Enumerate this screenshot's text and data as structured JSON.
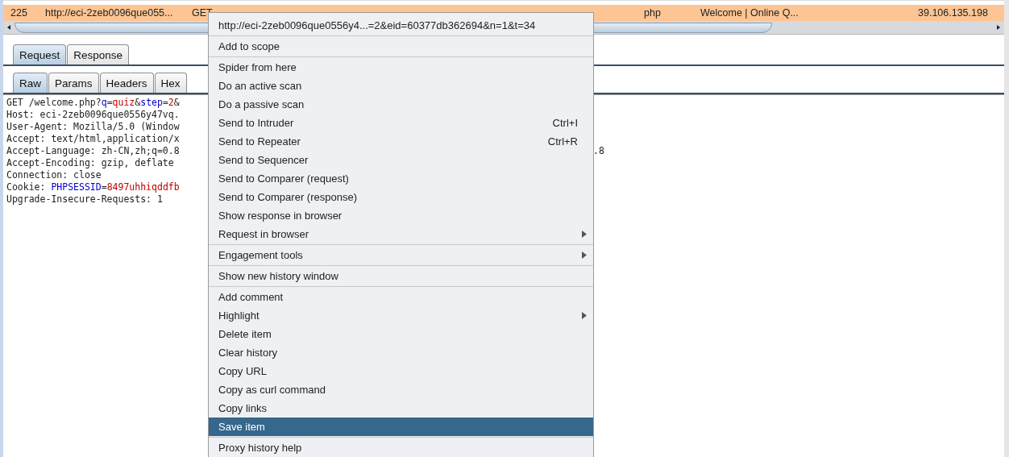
{
  "history_row": {
    "selected": true,
    "cells": [
      "225",
      "http://eci-2zeb0096que055...",
      "GET",
      "php",
      "Welcome | Online Q...",
      "39.106.135.198"
    ]
  },
  "tabs": [
    {
      "label": "Request",
      "selected": true
    },
    {
      "label": "Response",
      "selected": false
    }
  ],
  "subtabs": [
    {
      "label": "Raw",
      "selected": true
    },
    {
      "label": "Params",
      "selected": false
    },
    {
      "label": "Headers",
      "selected": false
    },
    {
      "label": "Hex",
      "selected": false
    }
  ],
  "request_lines": [
    {
      "segments": [
        {
          "kind": "plain",
          "text": "GET /welcome.php?"
        },
        {
          "kind": "name",
          "text": "q"
        },
        {
          "kind": "plain",
          "text": "="
        },
        {
          "kind": "value",
          "text": "quiz"
        },
        {
          "kind": "plain",
          "text": "&"
        },
        {
          "kind": "name",
          "text": "step"
        },
        {
          "kind": "plain",
          "text": "="
        },
        {
          "kind": "value",
          "text": "2"
        },
        {
          "kind": "plain",
          "text": "&"
        }
      ]
    },
    {
      "segments": [
        {
          "kind": "plain",
          "text": "Host: eci-2zeb0096que0556y47vq."
        }
      ]
    },
    {
      "segments": [
        {
          "kind": "plain",
          "text": "User-Agent: Mozilla/5.0 (Window"
        }
      ]
    },
    {
      "segments": [
        {
          "kind": "plain",
          "text": "Accept: text/html,application/x"
        }
      ]
    },
    {
      "segments": [
        {
          "kind": "plain",
          "text": "Accept-Language: zh-CN,zh;q=0.8"
        }
      ],
      "tail": ".8"
    },
    {
      "segments": [
        {
          "kind": "plain",
          "text": "Accept-Encoding: gzip, deflate"
        }
      ]
    },
    {
      "segments": [
        {
          "kind": "plain",
          "text": "Connection: close"
        }
      ]
    },
    {
      "segments": [
        {
          "kind": "plain",
          "text": "Cookie: "
        },
        {
          "kind": "name",
          "text": "PHPSESSID"
        },
        {
          "kind": "plain",
          "text": "="
        },
        {
          "kind": "value",
          "text": "8497uhhiqddfb"
        }
      ]
    },
    {
      "segments": [
        {
          "kind": "plain",
          "text": "Upgrade-Insecure-Requests: 1"
        }
      ]
    }
  ],
  "context_menu": {
    "sections": [
      [
        {
          "label": "http://eci-2zeb0096que0556y4...=2&eid=60377db362694&n=1&t=34",
          "has_submenu": false,
          "selected": false
        }
      ],
      [
        {
          "label": "Add to scope",
          "has_submenu": false,
          "selected": false
        }
      ],
      [
        {
          "label": "Spider from here",
          "has_submenu": false,
          "selected": false
        },
        {
          "label": "Do an active scan",
          "has_submenu": false,
          "selected": false
        },
        {
          "label": "Do a passive scan",
          "has_submenu": false,
          "selected": false
        },
        {
          "label": "Send to Intruder",
          "shortcut": "Ctrl+I",
          "has_submenu": false,
          "selected": false
        },
        {
          "label": "Send to Repeater",
          "shortcut": "Ctrl+R",
          "has_submenu": false,
          "selected": false
        },
        {
          "label": "Send to Sequencer",
          "has_submenu": false,
          "selected": false
        },
        {
          "label": "Send to Comparer (request)",
          "has_submenu": false,
          "selected": false
        },
        {
          "label": "Send to Comparer (response)",
          "has_submenu": false,
          "selected": false
        },
        {
          "label": "Show response in browser",
          "has_submenu": false,
          "selected": false
        },
        {
          "label": "Request in browser",
          "has_submenu": true,
          "selected": false
        }
      ],
      [
        {
          "label": "Engagement tools",
          "has_submenu": true,
          "selected": false
        }
      ],
      [
        {
          "label": "Show new history window",
          "has_submenu": false,
          "selected": false
        }
      ],
      [
        {
          "label": "Add comment",
          "has_submenu": false,
          "selected": false
        },
        {
          "label": "Highlight",
          "has_submenu": true,
          "selected": false
        },
        {
          "label": "Delete item",
          "has_submenu": false,
          "selected": false
        },
        {
          "label": "Clear history",
          "has_submenu": false,
          "selected": false
        },
        {
          "label": "Copy URL",
          "has_submenu": false,
          "selected": false
        },
        {
          "label": "Copy as curl command",
          "has_submenu": false,
          "selected": false
        },
        {
          "label": "Copy links",
          "has_submenu": false,
          "selected": false
        },
        {
          "label": "Save item",
          "has_submenu": false,
          "selected": true
        }
      ],
      [
        {
          "label": "Proxy history help",
          "has_submenu": false,
          "selected": false
        }
      ]
    ]
  }
}
